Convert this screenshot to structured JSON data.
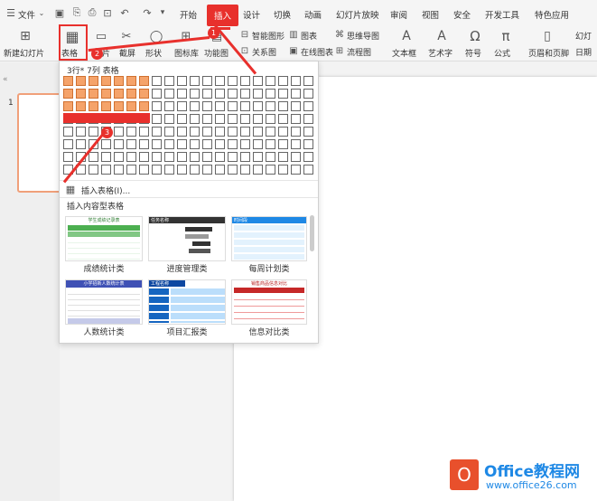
{
  "menubar": {
    "file_label": "文件",
    "items": [
      "开始",
      "插入",
      "设计",
      "切换",
      "动画",
      "幻灯片放映",
      "审阅",
      "视图",
      "安全",
      "开发工具",
      "特色应用"
    ]
  },
  "ribbon": {
    "new_slide": "新建幻灯片",
    "table": "表格",
    "image": "图片",
    "screenshot": "截屏",
    "shape": "形状",
    "icon_lib": "图标库",
    "func_chart": "功能图",
    "smart_art": "智能图形",
    "chart": "图表",
    "mindmap": "思维导图",
    "relation": "关系图",
    "online_chart": "在线图表",
    "flowchart": "流程图",
    "textbox": "文本框",
    "art_text": "艺术字",
    "symbol": "符号",
    "formula": "公式",
    "header_footer": "页眉和页脚",
    "right1": "幻灯",
    "right2": "日期"
  },
  "slide_panel": {
    "slide_number": "1"
  },
  "dropdown": {
    "grid_title": "3行* 7列 表格",
    "insert_table": "插入表格(I)...",
    "content_section": "插入内容型表格",
    "templates": [
      {
        "caption": "成绩统计类",
        "header": "学生成绩记录表"
      },
      {
        "caption": "进度管理类",
        "header": "任务名称"
      },
      {
        "caption": "每周计划类",
        "header": "时间段"
      },
      {
        "caption": "人数统计类",
        "header": "小学招新人数统计表"
      },
      {
        "caption": "项目汇报类",
        "header": "工程名称"
      },
      {
        "caption": "信息对比类",
        "header": "销售商品信息对比"
      }
    ]
  },
  "annotations": {
    "step1": "1",
    "step2": "2",
    "step3": "3"
  },
  "watermark": {
    "brand": "Office教程网",
    "url": "www.office26.com"
  },
  "colors": {
    "accent": "#e8302c",
    "grid_selected": "#f5a36a"
  }
}
